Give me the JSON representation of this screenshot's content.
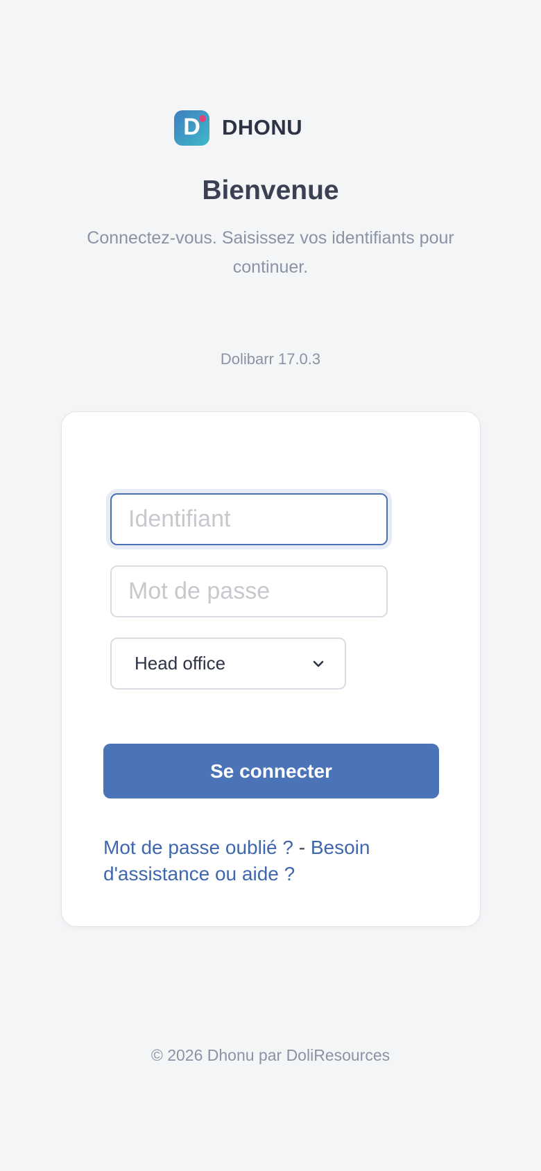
{
  "brand": {
    "logo_letter": "D",
    "name": "DHONU",
    "colors": {
      "logo_gradient_start": "#3f7fc0",
      "logo_gradient_end": "#3fb8c8",
      "logo_dot": "#e0457a"
    }
  },
  "header": {
    "title": "Bienvenue",
    "subtitle": "Connectez-vous. Saisissez vos identifiants pour continuer.",
    "version": "Dolibarr 17.0.3"
  },
  "form": {
    "login_placeholder": "Identifiant",
    "password_placeholder": "Mot de passe",
    "entity_selected": "Head office",
    "submit_label": "Se connecter",
    "forgot_password_link": "Mot de passe oublié ?",
    "links_separator": "-",
    "help_link": "Besoin d'assistance ou aide ?"
  },
  "footer": {
    "copyright": "© 2026 Dhonu par DoliResources"
  },
  "theme": {
    "accent": "#4a73b8",
    "link": "#3f67ad",
    "background": "#f4f5f7"
  }
}
